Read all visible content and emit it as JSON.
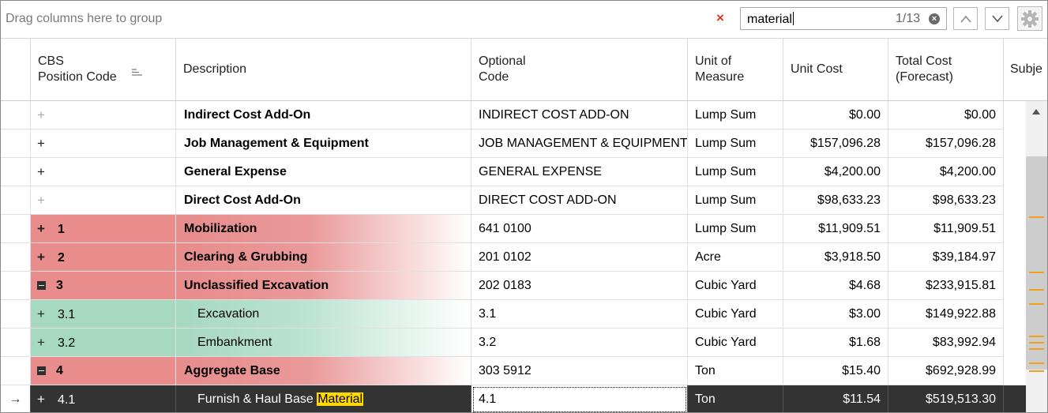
{
  "toolbar": {
    "group_hint": "Drag columns here to group",
    "clear_search_glyph": "×",
    "search_value": "material",
    "match_count": "1/13",
    "icons": [
      "clear-search-icon",
      "chevron-up-icon",
      "chevron-down-icon",
      "gear-icon"
    ]
  },
  "columns": {
    "cbs": "CBS\nPosition Code",
    "desc": "Description",
    "opt": "Optional\nCode",
    "uom": "Unit of\nMeasure",
    "unit": "Unit Cost",
    "total": "Total Cost\n(Forecast)",
    "subj": "Subje"
  },
  "rows": [
    {
      "cbs": "",
      "desc": "Indirect Cost Add-On",
      "opt": "INDIRECT COST ADD-ON",
      "uom": "Lump Sum",
      "unit": "$0.00",
      "total": "$0.00"
    },
    {
      "cbs": "",
      "desc": "Job Management & Equipment",
      "opt": "JOB MANAGEMENT & EQUIPMENT",
      "uom": "Lump Sum",
      "unit": "$157,096.28",
      "total": "$157,096.28"
    },
    {
      "cbs": "",
      "desc": "General Expense",
      "opt": "GENERAL EXPENSE",
      "uom": "Lump Sum",
      "unit": "$4,200.00",
      "total": "$4,200.00"
    },
    {
      "cbs": "",
      "desc": "Direct Cost Add-On",
      "opt": "DIRECT COST ADD-ON",
      "uom": "Lump Sum",
      "unit": "$98,633.23",
      "total": "$98,633.23"
    },
    {
      "cbs": "1",
      "desc": "Mobilization",
      "opt": "641 0100",
      "uom": "Lump Sum",
      "unit": "$11,909.51",
      "total": "$11,909.51"
    },
    {
      "cbs": "2",
      "desc": "Clearing & Grubbing",
      "opt": "201 0102",
      "uom": "Acre",
      "unit": "$3,918.50",
      "total": "$39,184.97"
    },
    {
      "cbs": "3",
      "desc": "Unclassified Excavation",
      "opt": "202 0183",
      "uom": "Cubic Yard",
      "unit": "$4.68",
      "total": "$233,915.81"
    },
    {
      "cbs": "3.1",
      "desc": "Excavation",
      "opt": "3.1",
      "uom": "Cubic Yard",
      "unit": "$3.00",
      "total": "$149,922.88"
    },
    {
      "cbs": "3.2",
      "desc": "Embankment",
      "opt": "3.2",
      "uom": "Cubic Yard",
      "unit": "$1.68",
      "total": "$83,992.94"
    },
    {
      "cbs": "4",
      "desc": "Aggregate Base",
      "opt": "303 5912",
      "uom": "Ton",
      "unit": "$15.40",
      "total": "$692,928.99"
    },
    {
      "cbs": "4.1",
      "desc_prefix": "Furnish & Haul Base ",
      "desc_highlight": "Material",
      "opt": "4.1",
      "uom": "Ton",
      "unit": "$11.54",
      "total": "$519,513.30"
    }
  ],
  "colors": {
    "red_row": "#e88c8c",
    "green_row": "#a6d8c2",
    "selected_row": "#333333",
    "search_highlight": "#ffd800",
    "scroll_marker": "#f0a020",
    "clear_x": "#e0321c"
  }
}
